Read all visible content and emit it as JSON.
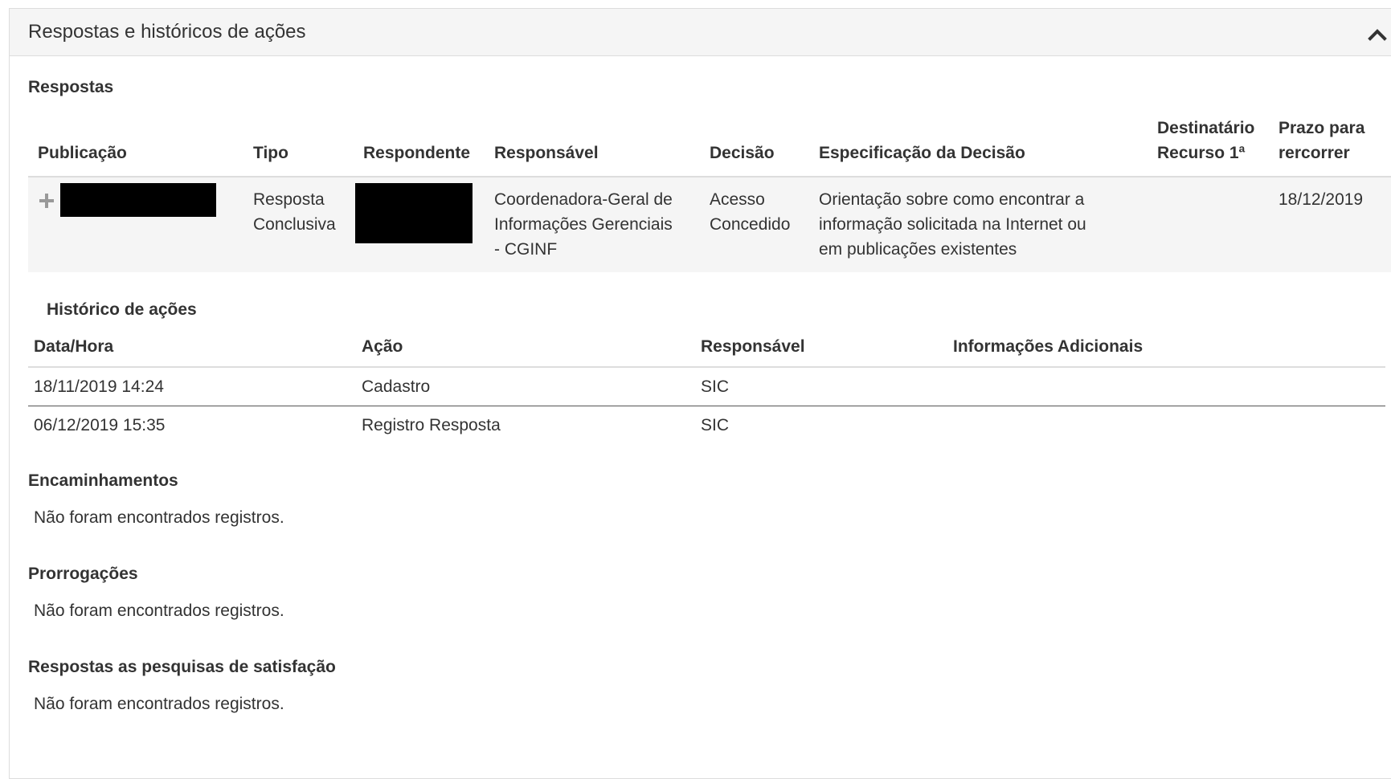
{
  "panel": {
    "title": "Respostas e históricos de ações",
    "collapse_icon": "chevron-up-icon"
  },
  "respostas": {
    "title": "Respostas",
    "headers": {
      "publicacao": "Publicação",
      "tipo": "Tipo",
      "respondente": "Respondente",
      "responsavel": "Responsável",
      "decisao": "Decisão",
      "especificacao": "Especificação da Decisão",
      "destinatario_l1": "Destinatário",
      "destinatario_l2": "Recurso 1ª",
      "prazo_l1": "Prazo para",
      "prazo_l2": "rercorrer"
    },
    "row": {
      "expand_icon": "plus-icon",
      "tipo_l1": "Resposta",
      "tipo_l2": "Conclusiva",
      "responsavel_l1": "Coordenadora-Geral de",
      "responsavel_l2": "Informações Gerenciais",
      "responsavel_l3": "- CGINF",
      "decisao_l1": "Acesso",
      "decisao_l2": "Concedido",
      "especificacao_l1": "Orientação sobre como encontrar a",
      "especificacao_l2": "informação solicitada na Internet ou",
      "especificacao_l3": "em publicações existentes",
      "destinatario": "",
      "prazo": "18/12/2019"
    }
  },
  "historico": {
    "title": "Histórico de ações",
    "headers": {
      "data_hora": "Data/Hora",
      "acao": "Ação",
      "responsavel": "Responsável",
      "info": "Informações Adicionais"
    },
    "rows": [
      {
        "data_hora": "18/11/2019 14:24",
        "acao": "Cadastro",
        "responsavel": "SIC",
        "info": ""
      },
      {
        "data_hora": "06/12/2019 15:35",
        "acao": "Registro Resposta",
        "responsavel": "SIC",
        "info": ""
      }
    ]
  },
  "encaminhamentos": {
    "title": "Encaminhamentos",
    "empty": "Não foram encontrados registros."
  },
  "prorrogacoes": {
    "title": "Prorrogações",
    "empty": "Não foram encontrados registros."
  },
  "pesquisas": {
    "title": "Respostas as pesquisas de satisfação",
    "empty": "Não foram encontrados registros."
  }
}
